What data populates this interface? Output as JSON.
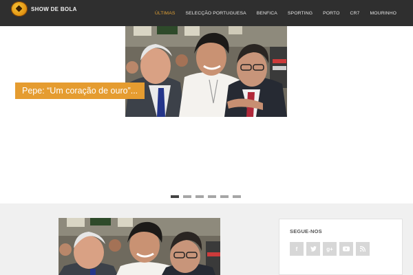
{
  "site": {
    "logo_text": "SHOW DE BOLA"
  },
  "nav": {
    "items": [
      {
        "label": "ÚLTIMAS",
        "active": true
      },
      {
        "label": "SELECÇÃO PORTUGUESA",
        "active": false
      },
      {
        "label": "BENFICA",
        "active": false
      },
      {
        "label": "SPORTING",
        "active": false
      },
      {
        "label": "PORTO",
        "active": false
      },
      {
        "label": "CR7",
        "active": false
      },
      {
        "label": "MOURINHO",
        "active": false
      }
    ]
  },
  "hero": {
    "caption": "Pepe: “Um coração de ouro”...",
    "slide_count": 6,
    "active_slide": 1
  },
  "sidebar": {
    "follow_title": "SEGUE-NOS",
    "social": [
      {
        "icon": "facebook-icon",
        "glyph": "f"
      },
      {
        "icon": "twitter-icon",
        "glyph": ""
      },
      {
        "icon": "google-plus-icon",
        "glyph": "g+"
      },
      {
        "icon": "youtube-icon",
        "glyph": ""
      },
      {
        "icon": "rss-icon",
        "glyph": ""
      }
    ]
  },
  "colors": {
    "nav_bg": "#2f2f2f",
    "accent": "#e59c30",
    "active_nav": "#e0a135"
  }
}
